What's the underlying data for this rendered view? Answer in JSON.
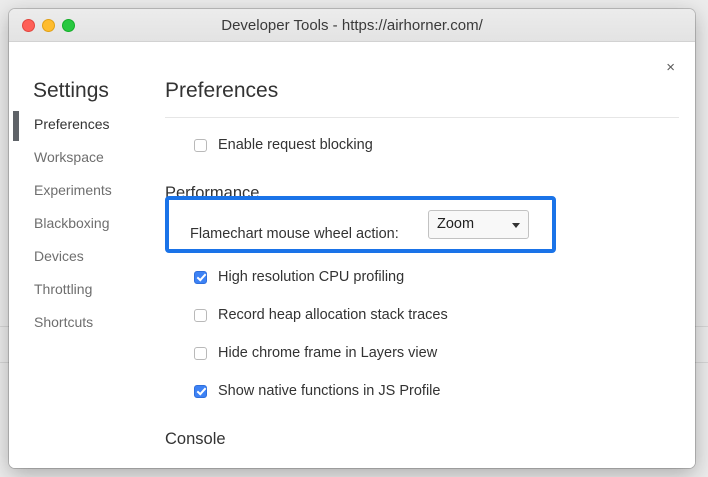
{
  "window": {
    "title": "Developer Tools - https://airhorner.com/"
  },
  "dialog": {
    "close_symbol": "×"
  },
  "sidebar": {
    "title": "Settings",
    "items": [
      {
        "label": "Preferences",
        "selected": true
      },
      {
        "label": "Workspace",
        "selected": false
      },
      {
        "label": "Experiments",
        "selected": false
      },
      {
        "label": "Blackboxing",
        "selected": false
      },
      {
        "label": "Devices",
        "selected": false
      },
      {
        "label": "Throttling",
        "selected": false
      },
      {
        "label": "Shortcuts",
        "selected": false
      }
    ]
  },
  "main": {
    "title": "Preferences",
    "request_blocking": {
      "label": "Enable request blocking",
      "checked": false
    },
    "performance": {
      "title": "Performance",
      "flamechart": {
        "label": "Flamechart mouse wheel action:",
        "value": "Zoom"
      },
      "options": [
        {
          "label": "High resolution CPU profiling",
          "checked": true
        },
        {
          "label": "Record heap allocation stack traces",
          "checked": false
        },
        {
          "label": "Hide chrome frame in Layers view",
          "checked": false
        },
        {
          "label": "Show native functions in JS Profile",
          "checked": true
        }
      ]
    },
    "console": {
      "title": "Console"
    }
  },
  "colors": {
    "highlight": "#1a73e8",
    "checkbox_checked": "#3d82f5",
    "traffic_close": "#fe5f57",
    "traffic_minimize": "#febc2e",
    "traffic_maximize": "#28c840"
  },
  "icons": {
    "close": "close-icon",
    "dropdown": "chevron-down-icon"
  }
}
